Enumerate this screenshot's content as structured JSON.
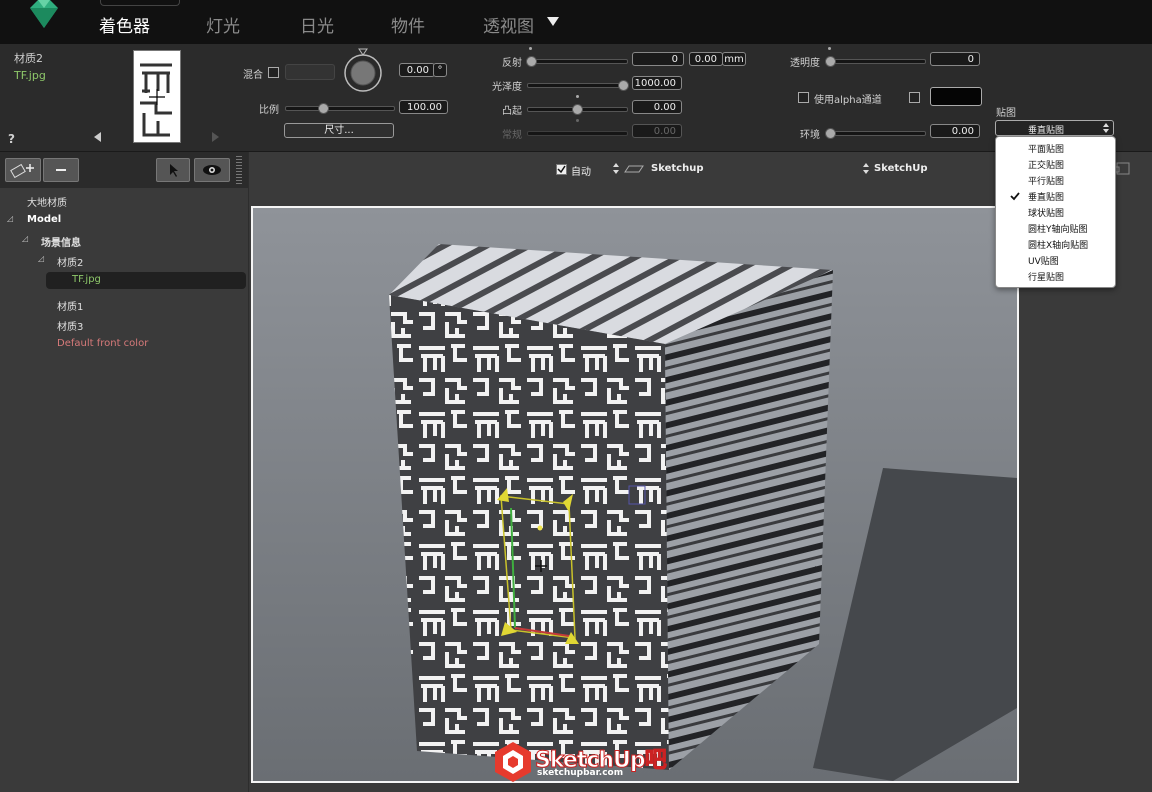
{
  "nav": {
    "tabs": [
      "着色器",
      "灯光",
      "日光",
      "物件",
      "透视图"
    ],
    "active_tab": "着色器"
  },
  "material": {
    "name": "材质2",
    "file": "TF.jpg",
    "help": "?"
  },
  "params": {
    "blend_label": "混合",
    "angle_value": "0.00",
    "angle_unit": "°",
    "scale_label": "比例",
    "scale_value": "100.00",
    "size_button": "尺寸...",
    "reflect_label": "反射",
    "reflect_value": "0",
    "reflect_mm_value": "0.00",
    "reflect_mm_unit": "mm",
    "gloss_label": "光泽度",
    "gloss_value": "1000.00",
    "bump_label": "凸起",
    "bump_value": "0.00",
    "normal_label": "常规",
    "normal_value": "0.00",
    "transparency_label": "透明度",
    "transparency_value": "0",
    "alpha_label": "使用alpha通道",
    "env_label": "环境",
    "env_value": "0.00",
    "map_label": "贴图",
    "map_selected": "垂直贴图"
  },
  "mapping_menu": {
    "options": [
      "平面贴图",
      "正交贴图",
      "平行贴图",
      "垂直贴图",
      "球状贴图",
      "圆柱Y轴向贴图",
      "圆柱X轴向贴图",
      "UV贴图",
      "行星贴图"
    ],
    "checked_index": 3
  },
  "viewport_toolbar": {
    "auto_label": "自动",
    "sketchup_label": "Sketchup",
    "sketchup2_label": "SketchUp"
  },
  "tree": {
    "root": "大地材质",
    "model": "Model",
    "scene_info": "场景信息",
    "material2": "材质2",
    "tf": "TF.jpg",
    "material1": "材质1",
    "material3": "材质3",
    "default_front": "Default front color"
  },
  "watermark": {
    "brand": "SketchUp吧",
    "url": "sketchupbar.com"
  },
  "colors": {
    "accent_green": "#8ec86a",
    "default_color_red": "#d77a7a",
    "topbar": "#111111",
    "panel": "#2b2b2b"
  }
}
